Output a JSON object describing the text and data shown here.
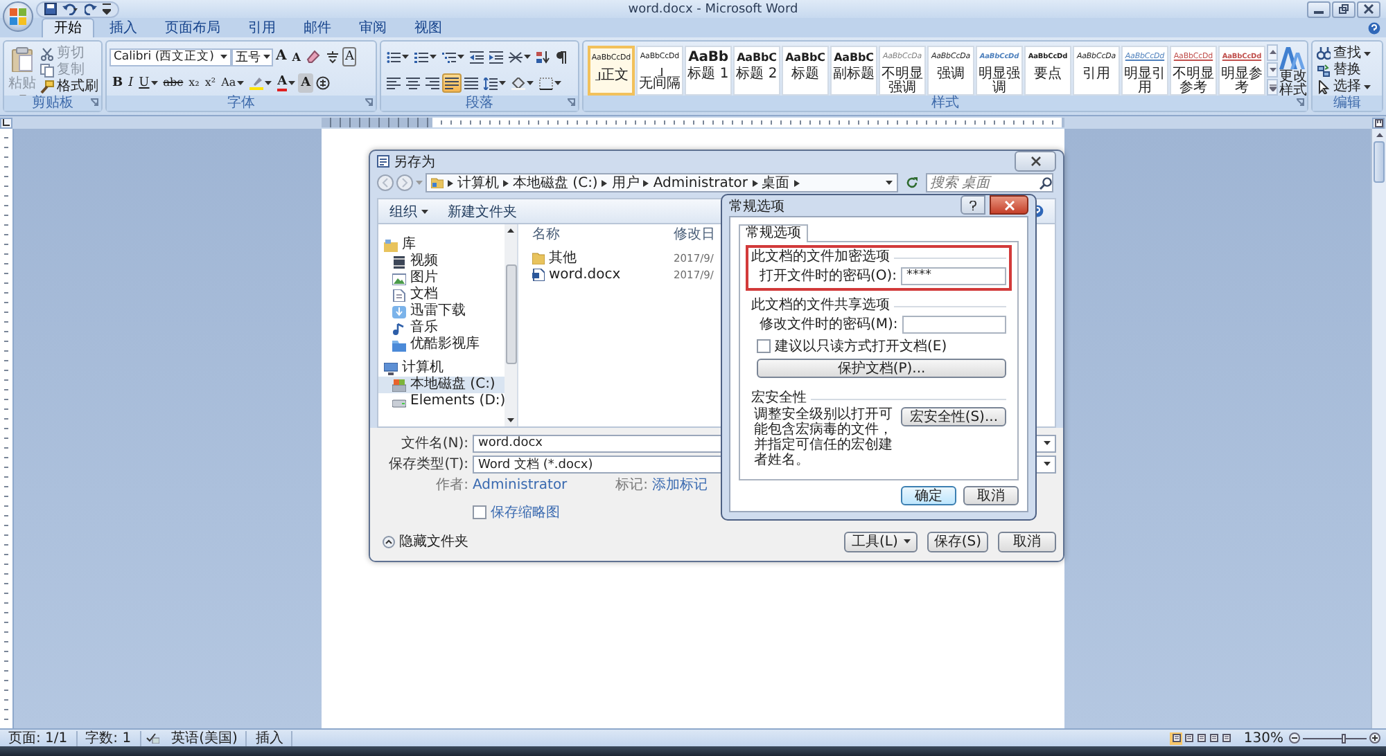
{
  "window": {
    "title": "word.docx - Microsoft Word"
  },
  "tabs": [
    {
      "label": "开始",
      "selected": true
    },
    {
      "label": "插入",
      "selected": false
    },
    {
      "label": "页面布局",
      "selected": false
    },
    {
      "label": "引用",
      "selected": false
    },
    {
      "label": "邮件",
      "selected": false
    },
    {
      "label": "审阅",
      "selected": false
    },
    {
      "label": "视图",
      "selected": false
    }
  ],
  "ribbon": {
    "clipboard": {
      "title": "剪贴板",
      "paste": {
        "label": "粘贴",
        "disabled": true
      },
      "items": [
        {
          "label": "剪切",
          "disabled": true
        },
        {
          "label": "复制",
          "disabled": true
        },
        {
          "label": "格式刷",
          "disabled": false
        }
      ]
    },
    "font": {
      "title": "字体",
      "font_name": "Calibri (西文正文)",
      "font_size": "五号",
      "grow": "A",
      "shrink": "A",
      "char_border": "A",
      "format_buttons": [
        {
          "label": "B",
          "dropdown": false
        },
        {
          "label": "I",
          "dropdown": false
        },
        {
          "label": "U",
          "dropdown": true
        },
        {
          "label": "abc",
          "dropdown": false
        },
        {
          "label": "x₂",
          "dropdown": false
        },
        {
          "label": "x²",
          "dropdown": false
        },
        {
          "label": "Aa",
          "dropdown": true
        }
      ],
      "font_color": "A",
      "char_shading": "A"
    },
    "paragraph": {
      "title": "段落",
      "alignments": [
        {
          "selected": false
        },
        {
          "selected": false
        },
        {
          "selected": false
        },
        {
          "selected": true
        },
        {
          "selected": false
        }
      ]
    },
    "styles": {
      "title": "样式",
      "items": [
        {
          "sample": "AaBbCcDd",
          "label": "正文",
          "kind": "normal",
          "paragraph_mark": true,
          "selected": true
        },
        {
          "sample": "AaBbCcDd",
          "label": "无间隔",
          "kind": "normal",
          "paragraph_mark": true,
          "selected": false
        },
        {
          "sample": "AaBb",
          "label": "标题 1",
          "kind": "heading1",
          "paragraph_mark": false,
          "selected": false
        },
        {
          "sample": "AaBbC",
          "label": "标题 2",
          "kind": "heading2",
          "paragraph_mark": false,
          "selected": false
        },
        {
          "sample": "AaBbC",
          "label": "标题",
          "kind": "title",
          "paragraph_mark": false,
          "selected": false
        },
        {
          "sample": "AaBbC",
          "label": "副标题",
          "kind": "title",
          "paragraph_mark": false,
          "selected": false
        },
        {
          "sample": "AaBbCcDa",
          "label": "不明显强调",
          "kind": "subtle",
          "paragraph_mark": false,
          "selected": false
        },
        {
          "sample": "AaBbCcDa",
          "label": "强调",
          "kind": "emphasis",
          "paragraph_mark": false,
          "selected": false
        },
        {
          "sample": "AaBbCcDd",
          "label": "明显强调",
          "kind": "intense",
          "paragraph_mark": false,
          "selected": false
        },
        {
          "sample": "AaBbCcDd",
          "label": "要点",
          "kind": "strong",
          "paragraph_mark": false,
          "selected": false
        },
        {
          "sample": "AaBbCcDa",
          "label": "引用",
          "kind": "emphasis",
          "paragraph_mark": false,
          "selected": false
        },
        {
          "sample": "AaBbCcDd",
          "label": "明显引用",
          "kind": "intense-quote",
          "paragraph_mark": false,
          "selected": false
        },
        {
          "sample": "AaBbCcDd",
          "label": "不明显参考",
          "kind": "subtle-ref",
          "paragraph_mark": false,
          "selected": false
        },
        {
          "sample": "AaBbCcDd",
          "label": "明显参考",
          "kind": "intense-ref",
          "paragraph_mark": false,
          "selected": false
        }
      ],
      "change_styles": "更改样式"
    },
    "editing": {
      "title": "编辑",
      "items": [
        {
          "label": "查找",
          "dropdown": true
        },
        {
          "label": "替换",
          "dropdown": false
        },
        {
          "label": "选择",
          "dropdown": true
        }
      ]
    }
  },
  "save_dialog": {
    "title": "另存为",
    "breadcrumb": [
      "计算机",
      "本地磁盘 (C:)",
      "用户",
      "Administrator",
      "桌面"
    ],
    "search": {
      "placeholder": "搜索 桌面"
    },
    "toolbar": [
      {
        "label": "组织",
        "dropdown": true
      },
      {
        "label": "新建文件夹",
        "dropdown": false
      }
    ],
    "nav": [
      {
        "label": "库",
        "kind": "library",
        "selected": false,
        "children": [
          {
            "label": "视频",
            "kind": "video",
            "selected": false
          },
          {
            "label": "图片",
            "kind": "pictures",
            "selected": false
          },
          {
            "label": "文档",
            "kind": "documents",
            "selected": false
          },
          {
            "label": "迅雷下载",
            "kind": "download",
            "selected": false
          },
          {
            "label": "音乐",
            "kind": "music",
            "selected": false
          },
          {
            "label": "优酷影视库",
            "kind": "media",
            "selected": false
          }
        ]
      },
      {
        "label": "计算机",
        "kind": "computer",
        "selected": false,
        "children": [
          {
            "label": "本地磁盘 (C:)",
            "kind": "system-drive",
            "selected": true
          },
          {
            "label": "Elements (D:)",
            "kind": "drive",
            "selected": false
          }
        ]
      }
    ],
    "columns": [
      "名称",
      "修改日"
    ],
    "files": [
      {
        "name": "其他",
        "kind": "folder",
        "modified": "2017/9/"
      },
      {
        "name": "word.docx",
        "kind": "document",
        "modified": "2017/9/"
      }
    ],
    "file_name": {
      "label": "文件名(N):",
      "value": "word.docx"
    },
    "save_type": {
      "label": "保存类型(T):",
      "value": "Word 文档 (*.docx)"
    },
    "author": {
      "label": "作者:",
      "value": "Administrator"
    },
    "tags": {
      "label": "标记:",
      "value": "添加标记"
    },
    "thumbnail": {
      "label": "保存缩略图",
      "checked": false
    },
    "hide_folders": "隐藏文件夹",
    "buttons": [
      {
        "label": "工具(L)",
        "dropdown": true
      },
      {
        "label": "保存(S)",
        "dropdown": false
      },
      {
        "label": "取消",
        "dropdown": false
      }
    ]
  },
  "options_dialog": {
    "title": "常规选项",
    "tab": {
      "label": "常规选项",
      "selected": true
    },
    "encryption": {
      "heading": "此文档的文件加密选项",
      "highlighted": true,
      "label": "打开文件时的密码(O):",
      "value": "****"
    },
    "sharing": {
      "heading": "此文档的文件共享选项",
      "highlighted": false,
      "label": "修改文件时的密码(M):",
      "read_only": {
        "label": "建议以只读方式打开文档(E)",
        "checked": false
      },
      "protect_button": "保护文档(P)..."
    },
    "macro": {
      "heading": "宏安全性",
      "text": "调整安全级别以打开可能包含宏病毒的文件，并指定可信任的宏创建者姓名。",
      "button": "宏安全性(S)..."
    },
    "buttons": [
      "确定",
      "取消"
    ]
  },
  "status_bar": {
    "items": [
      "页面: 1/1",
      "字数: 1",
      "英语(美国)",
      "插入"
    ],
    "views": [
      {
        "selected": true
      },
      {
        "selected": false
      },
      {
        "selected": false
      },
      {
        "selected": false
      },
      {
        "selected": false
      }
    ],
    "zoom": "130%",
    "zoom_level": {
      "level": 0.62
    }
  }
}
